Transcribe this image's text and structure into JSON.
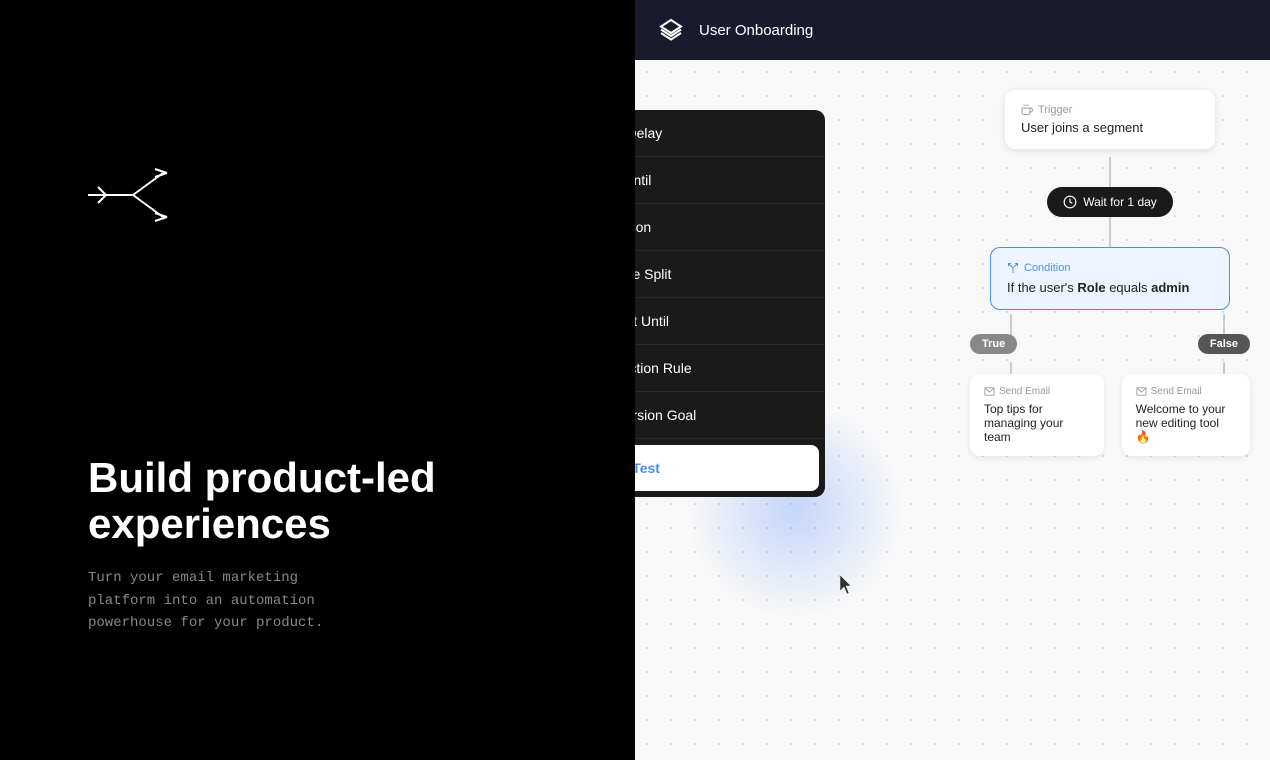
{
  "left": {
    "headline_line1": "Build product-led",
    "headline_line2": "experiences",
    "description": "Turn your email marketing\nplatform into an automation\npowerhouse for your product."
  },
  "header": {
    "title": "User Onboarding",
    "logo_icon": "layers-icon"
  },
  "menu": {
    "items": [
      {
        "id": "time-delay",
        "label": "Time Delay",
        "icon": "clock"
      },
      {
        "id": "wait-until",
        "label": "Wait Until",
        "icon": "pause-circle"
      },
      {
        "id": "condition",
        "label": "Condition",
        "icon": "split"
      },
      {
        "id": "multiple-split",
        "label": "Multiple Split",
        "icon": "diagram"
      },
      {
        "id": "repeat-until",
        "label": "Repeat Until",
        "icon": "repeat"
      },
      {
        "id": "production-rule",
        "label": "Production Rule",
        "icon": "shuffle"
      },
      {
        "id": "conversion-goal",
        "label": "Conversion Goal",
        "icon": "target"
      },
      {
        "id": "split-test",
        "label": "Split Test",
        "icon": "flask"
      }
    ]
  },
  "flow": {
    "trigger_label": "Trigger",
    "trigger_content": "User joins a segment",
    "wait_badge": "Wait for 1 day",
    "condition_label": "Condition",
    "condition_text_prefix": "If the user's",
    "condition_field": "Role",
    "condition_operator": "equals",
    "condition_value": "admin",
    "true_badge": "True",
    "false_badge": "False",
    "email1_label": "Send Email",
    "email1_title": "Top tips for managing your team",
    "email2_label": "Send Email",
    "email2_title": "Welcome to your new editing tool 🔥"
  }
}
